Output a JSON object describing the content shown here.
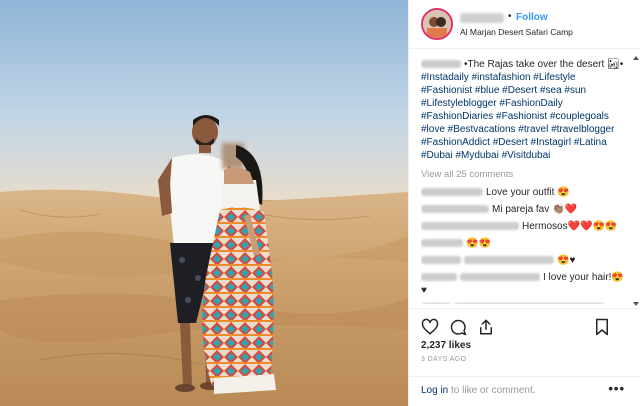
{
  "post": {
    "follow_label": "Follow",
    "separator": "•",
    "location": "Al Marjan Desert Safari Camp"
  },
  "caption": {
    "text": "•The Rajas take over the desert 🏜•",
    "hashtags": "#Instadaily #instafashion #Lifestyle #Fashionist #blue #Desert #sea #sun #Lifestyleblogger #FashionDaily #FashionDiaries #Fashionist #couplegoals #love #Bestvacations #travel #travelblogger #FashionAddict #Desert #Instagirl #Latina #Dubai #Mydubai #Visitdubai"
  },
  "view_all_label": "View all 25 comments",
  "comments": [
    {
      "text": "Love your outfit 😍"
    },
    {
      "text": "Mi pareja fav 👏🏽❤️"
    },
    {
      "text": "Hermosos❤️❤️😍😍"
    },
    {
      "text": "😍😍"
    },
    {
      "text": "😍♥"
    },
    {
      "text": "I love your hair!😍♥"
    }
  ],
  "stats": {
    "likes": "2,237 likes",
    "time": "3 DAYS AGO"
  },
  "login": {
    "link": "Log in",
    "rest": " to like or comment.",
    "more": "•••"
  },
  "colors": {
    "link_blue": "#3897f0",
    "hashtag_blue": "#003569",
    "muted": "#999999"
  },
  "icons": [
    "heart-icon",
    "comment-icon",
    "share-icon",
    "bookmark-icon"
  ]
}
